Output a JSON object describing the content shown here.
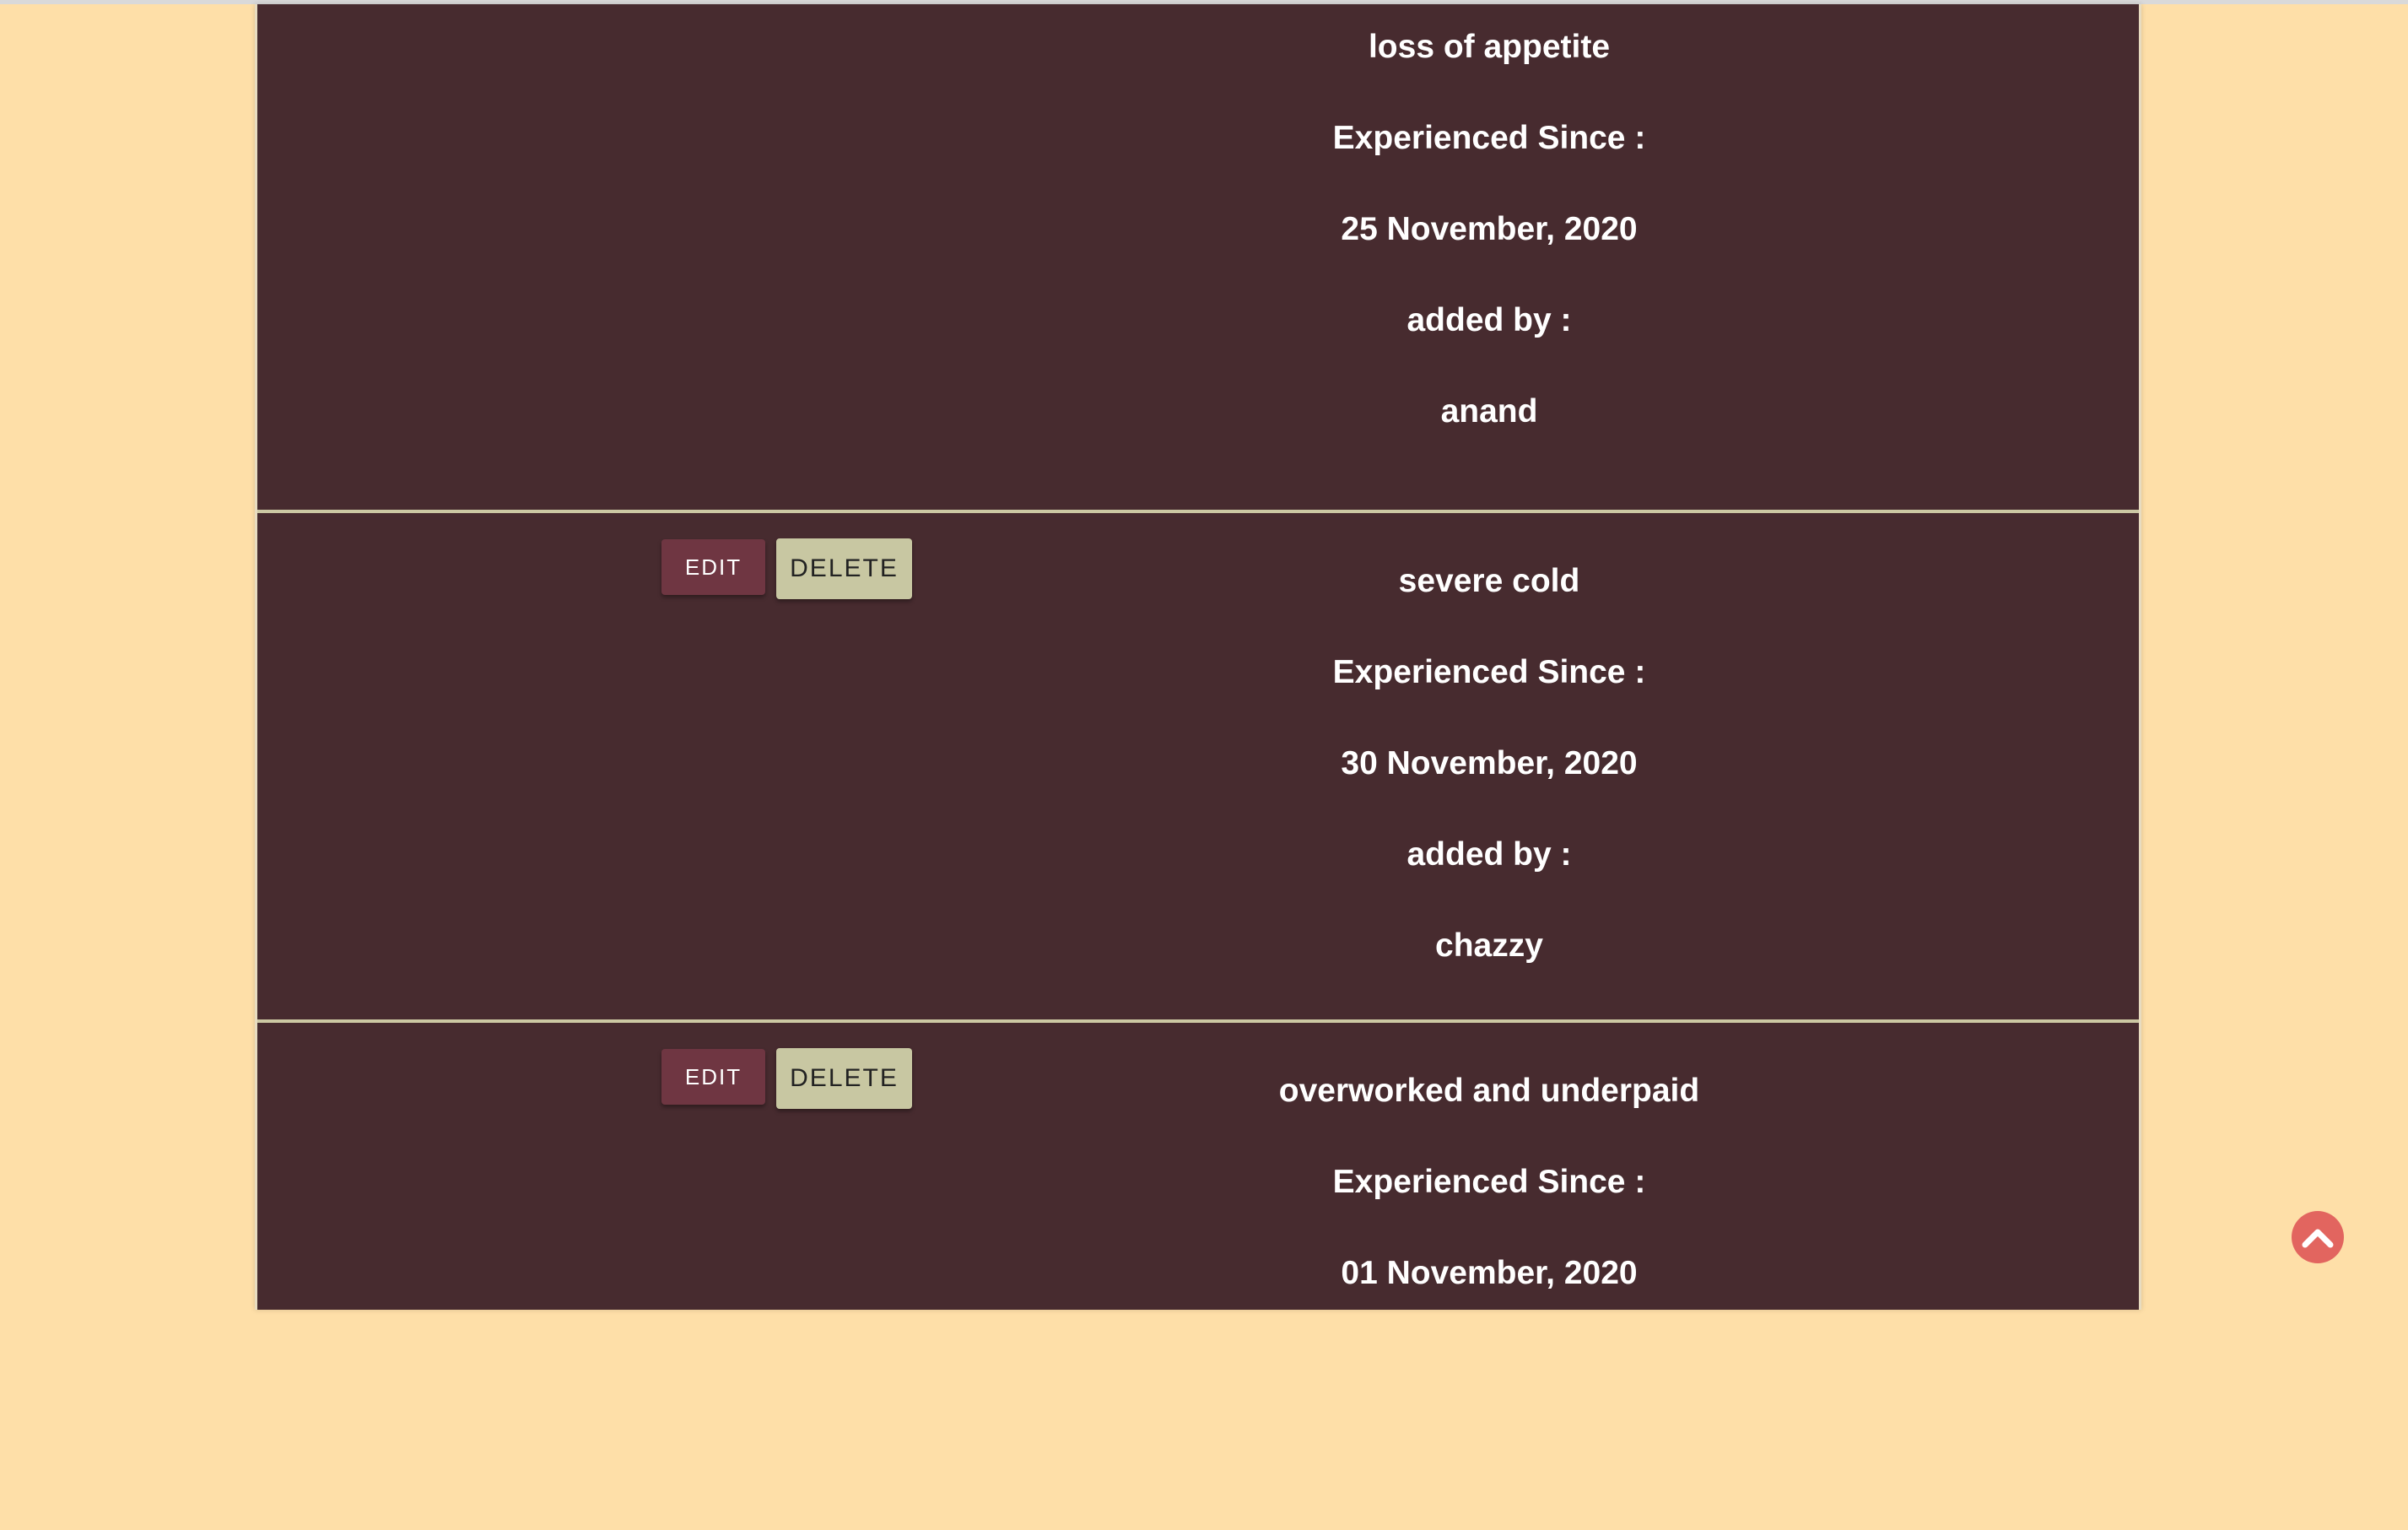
{
  "cards": [
    {
      "symptom": "loss of appetite",
      "since_label": "Experienced Since :",
      "date": "25 November, 2020",
      "added_by_label": "added by :",
      "user": "anand"
    },
    {
      "symptom": "severe cold",
      "since_label": "Experienced Since :",
      "date": "30 November, 2020",
      "added_by_label": "added by :",
      "user": "chazzy",
      "edit_label": "EDIT",
      "delete_label": "DELETE"
    },
    {
      "symptom": "overworked and underpaid",
      "since_label": "Experienced Since :",
      "date": "01 November, 2020",
      "edit_label": "EDIT",
      "delete_label": "DELETE"
    }
  ],
  "scroll_top_icon": "chevron-up-circle-icon",
  "colors": {
    "page_background": "#fedfa8",
    "panel_background": "#472b2f",
    "divider": "#ccc8a3",
    "edit_button": "#6f3642",
    "delete_button": "#c8c7a2",
    "scroll_top_button": "#e2655f"
  }
}
